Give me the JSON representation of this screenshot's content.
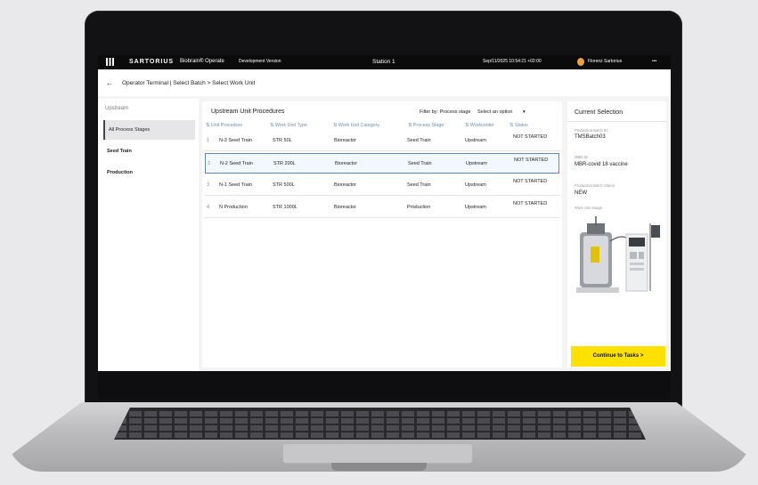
{
  "header": {
    "brand": "SARTORIUS",
    "app_name": "Biobrain® Operate",
    "version": "Development Version",
    "station": "Station 1",
    "datetime": "Sep/11/2025 10:54:21 +02:00",
    "user": "Florenz Sartorius",
    "more": "•••"
  },
  "nav": {
    "back_icon": "←",
    "breadcrumb": "Operator Terminal | Select Batch > Select Work Unit"
  },
  "left_panel": {
    "title": "Upstream",
    "items": [
      "All Process Stages",
      "Seed Train",
      "Production"
    ]
  },
  "table": {
    "title": "Upstream Unit Procedures",
    "filter_label": "Filter by:",
    "filter_field": "Process stage",
    "filter_value": "Select an option",
    "filter_chevron": "▾",
    "columns": [
      "⇅ Unit Procedure",
      "⇅ Work Unit Type",
      "⇅ Work Unit Category",
      "⇅ Process Stage",
      "⇅ Workcenter",
      "⇅ Status"
    ],
    "rows": [
      {
        "num": "1",
        "procedure": "N-3 Seed Train",
        "type": "STR 50L",
        "category": "Bioreactor",
        "stage": "Seed Train",
        "workcenter": "Upstream",
        "status": "NOT STARTED"
      },
      {
        "num": "2",
        "procedure": "N-2 Seed Train",
        "type": "STR 200L",
        "category": "Bioreactor",
        "stage": "Seed Train",
        "workcenter": "Upstream",
        "status": "NOT STARTED"
      },
      {
        "num": "3",
        "procedure": "N-1 Seed Train",
        "type": "STR 500L",
        "category": "Bioreactor",
        "stage": "Seed Train",
        "workcenter": "Upstream",
        "status": "NOT STARTED"
      },
      {
        "num": "4",
        "procedure": "N Production",
        "type": "STR 1000L",
        "category": "Bioreactor",
        "stage": "Production",
        "workcenter": "Upstream",
        "status": "NOT STARTED"
      }
    ]
  },
  "selection": {
    "title": "Current Selection",
    "batch_label": "Production Batch ID",
    "batch_value": "TMSBatch03",
    "mbr_label": "MBR ID",
    "mbr_value": "MBR-covid 18 vaccine",
    "status_label": "Production Batch Status",
    "status_value": "NEW",
    "image_label": "Work Unit Image",
    "continue_label": "Continue to Tasks  >"
  },
  "colors": {
    "accent": "#ffe100",
    "selected_border": "#5c86c6",
    "header_bg": "#0b0b0b"
  },
  "icons": [
    "grid-icon",
    "back-arrow-icon",
    "user-avatar-icon",
    "sort-icon",
    "chevron-down-icon",
    "chevron-right-icon"
  ]
}
